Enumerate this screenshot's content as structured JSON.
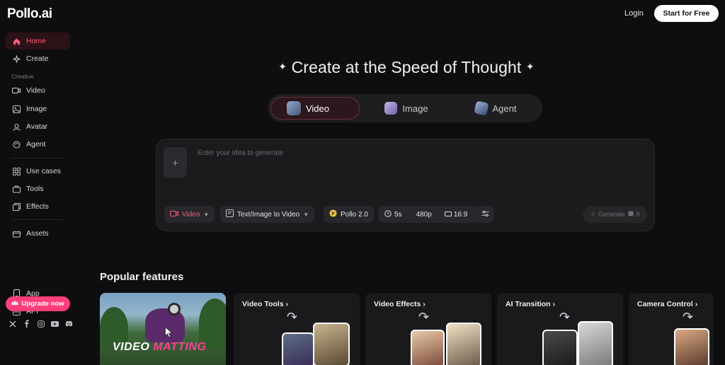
{
  "brand": {
    "name": "Pollo",
    "suffix": ".ai"
  },
  "header": {
    "login": "Login",
    "start_button": "Start for Free"
  },
  "sidebar": {
    "items": [
      {
        "label": "Home",
        "icon": "home-icon",
        "active": true
      },
      {
        "label": "Create",
        "icon": "sparkle-icon"
      }
    ],
    "section_label": "Creative",
    "creative_items": [
      {
        "label": "Video",
        "icon": "video-icon"
      },
      {
        "label": "Image",
        "icon": "image-icon"
      },
      {
        "label": "Avatar",
        "icon": "avatar-icon"
      },
      {
        "label": "Agent",
        "icon": "agent-icon"
      }
    ],
    "more_items": [
      {
        "label": "Use cases",
        "icon": "grid-icon"
      },
      {
        "label": "Tools",
        "icon": "tools-icon"
      },
      {
        "label": "Effects",
        "icon": "effects-icon"
      }
    ],
    "assets": {
      "label": "Assets",
      "icon": "folder-icon"
    },
    "bottom_items": [
      {
        "label": "App",
        "icon": "phone-icon"
      },
      {
        "label": "API",
        "icon": "api-icon"
      }
    ],
    "upgrade": "Upgrade now"
  },
  "hero": {
    "title": "Create at the Speed of Thought",
    "tabs": [
      {
        "label": "Video",
        "active": true
      },
      {
        "label": "Image"
      },
      {
        "label": "Agent"
      }
    ]
  },
  "prompt": {
    "placeholder": "Enter your idea to generate",
    "add_symbol": "+",
    "mode": "Video",
    "input_type": "Text/Image to Video",
    "model": "Pollo 2.0",
    "duration": "5s",
    "resolution": "480p",
    "aspect": "16:9",
    "generate": "Generate",
    "credits": "8"
  },
  "features": {
    "title": "Popular features",
    "cards": [
      {
        "label": "VIDEO",
        "label2": "MATTING"
      },
      {
        "label": "Video Tools"
      },
      {
        "label": "Video Effects"
      },
      {
        "label": "AI Transition"
      },
      {
        "label": "Camera Control"
      }
    ]
  },
  "colors": {
    "accent": "#ff3e7b",
    "accent_text": "#ff5a7a",
    "background": "#0e0e10",
    "panel": "#1b1b1e"
  }
}
